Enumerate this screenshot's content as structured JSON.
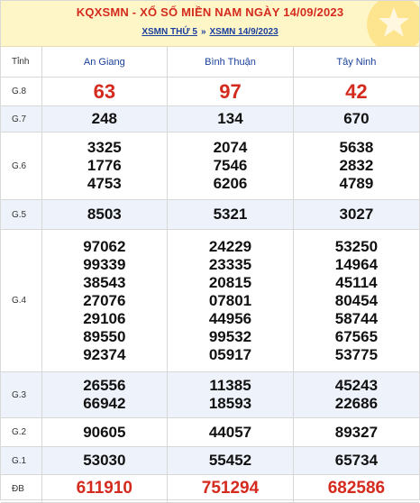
{
  "header": {
    "title": "KQXSMN - XỔ SỐ MIỀN NAM NGÀY 14/09/2023",
    "link_day": "XSMN THỨ 5",
    "separator": "»",
    "link_date": "XSMN 14/9/2023"
  },
  "table": {
    "label_header": "Tỉnh",
    "provinces": [
      "An Giang",
      "Bình Thuận",
      "Tây Ninh"
    ],
    "prizes": {
      "g8": {
        "label": "G.8",
        "values": [
          "63",
          "97",
          "42"
        ]
      },
      "g7": {
        "label": "G.7",
        "values": [
          "248",
          "134",
          "670"
        ]
      },
      "g6": {
        "label": "G.6",
        "values": [
          [
            "3325",
            "1776",
            "4753"
          ],
          [
            "2074",
            "7546",
            "6206"
          ],
          [
            "5638",
            "2832",
            "4789"
          ]
        ]
      },
      "g5": {
        "label": "G.5",
        "values": [
          "8503",
          "5321",
          "3027"
        ]
      },
      "g4": {
        "label": "G.4",
        "values": [
          [
            "97062",
            "99339",
            "38543",
            "27076",
            "29106",
            "89550",
            "92374"
          ],
          [
            "24229",
            "23335",
            "20815",
            "07801",
            "44956",
            "99532",
            "05917"
          ],
          [
            "53250",
            "14964",
            "45114",
            "80454",
            "58744",
            "67565",
            "53775"
          ]
        ]
      },
      "g3": {
        "label": "G.3",
        "values": [
          [
            "26556",
            "66942"
          ],
          [
            "11385",
            "18593"
          ],
          [
            "45243",
            "22686"
          ]
        ]
      },
      "g2": {
        "label": "G.2",
        "values": [
          "90605",
          "44057",
          "89327"
        ]
      },
      "g1": {
        "label": "G.1",
        "values": [
          "53030",
          "55452",
          "65734"
        ]
      },
      "db": {
        "label": "ĐB",
        "values": [
          "611910",
          "751294",
          "682586"
        ]
      }
    }
  },
  "colors": {
    "accent_red": "#d42b1e",
    "link_blue": "#1a3f9c",
    "header_bg": "#fff6c8",
    "alt_row": "#eef2fa"
  },
  "icons": {
    "decoration": "star-icon"
  }
}
